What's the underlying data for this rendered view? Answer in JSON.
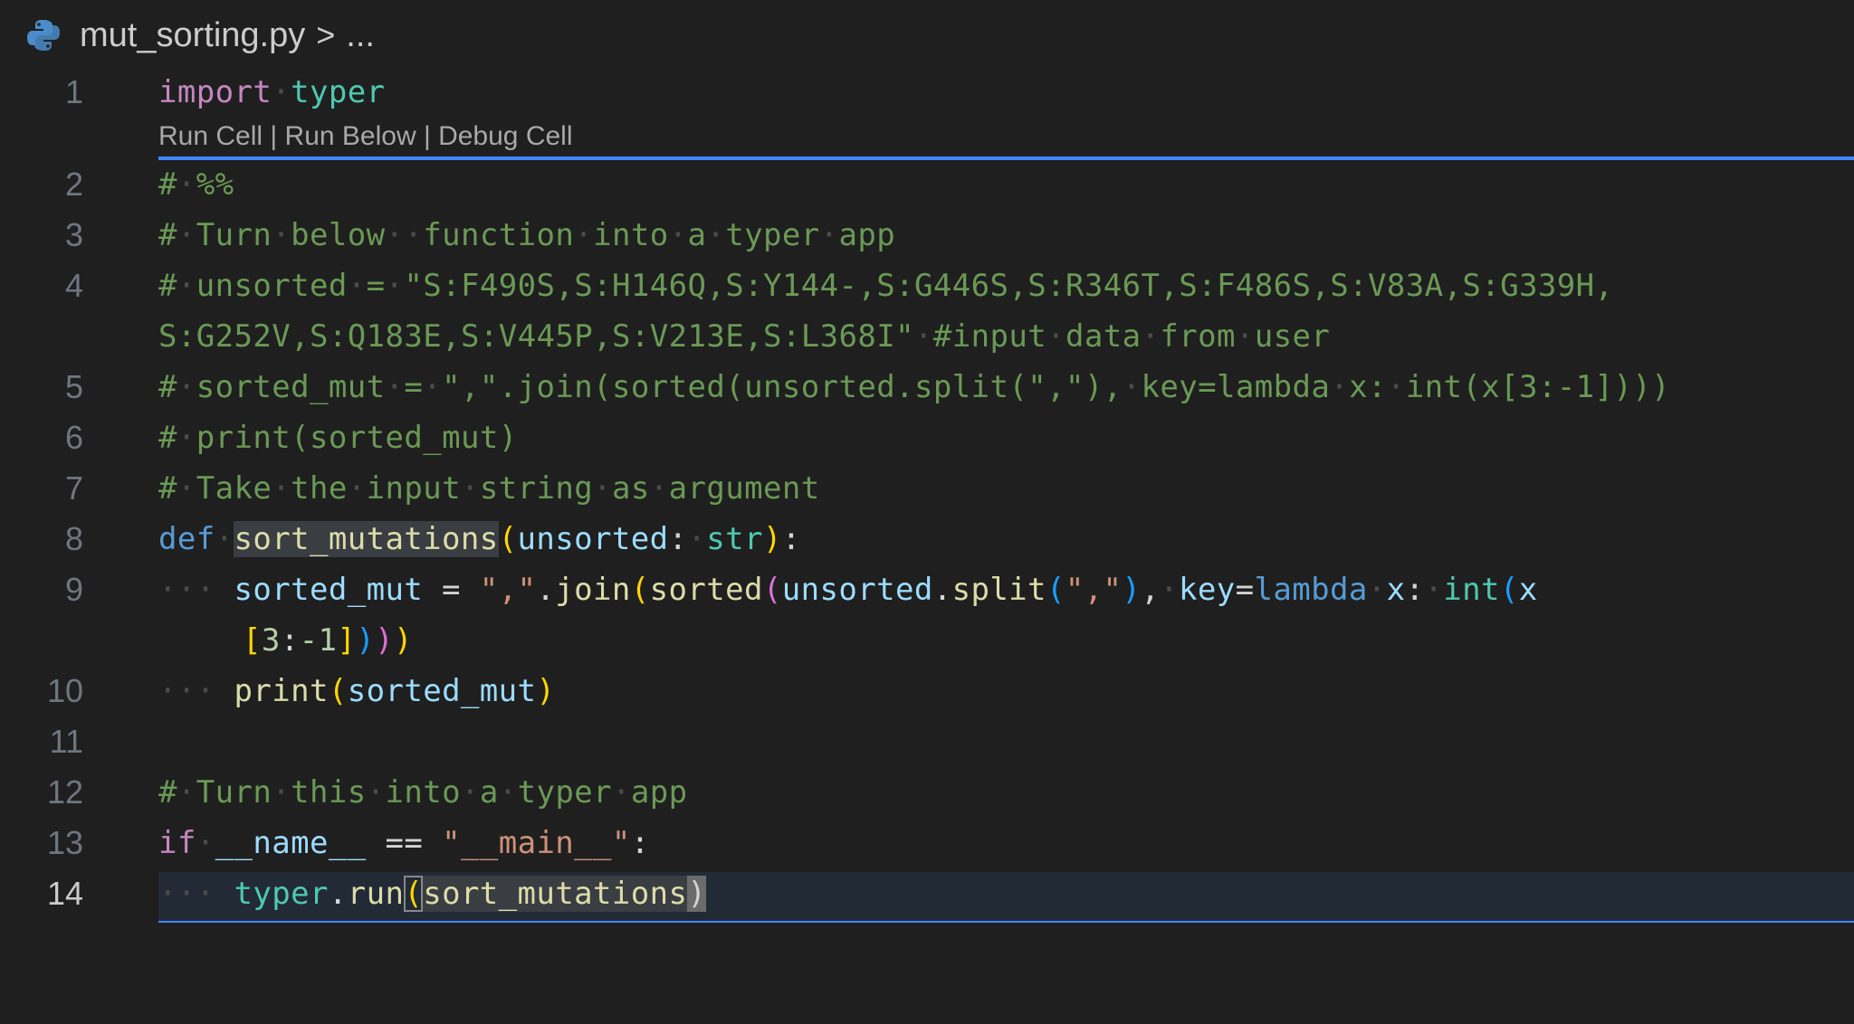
{
  "breadcrumb": {
    "file_name": "mut_sorting.py",
    "separator": ">",
    "ellipsis": "..."
  },
  "codelens": {
    "run_cell": "Run Cell",
    "run_below": "Run Below",
    "debug_cell": "Debug Cell",
    "divider": " | "
  },
  "line_numbers": [
    "1",
    "2",
    "3",
    "4",
    "5",
    "6",
    "7",
    "8",
    "9",
    "10",
    "11",
    "12",
    "13",
    "14"
  ],
  "lines": {
    "l1": {
      "import": "import",
      "module": "typer"
    },
    "l2": {
      "comment": "# %%"
    },
    "l3": {
      "comment": "# Turn below  function into a typer app"
    },
    "l4a": {
      "comment": "# unsorted = \"S:F490S,S:H146Q,S:Y144-,S:G446S,S:R346T,S:F486S,S:V83A,S:G339H,"
    },
    "l4b": {
      "comment": "S:G252V,S:Q183E,S:V445P,S:V213E,S:L368I\" #input data from user"
    },
    "l5": {
      "comment": "# sorted_mut = \",\".join(sorted(unsorted.split(\",\"), key=lambda x: int(x[3:-1])))"
    },
    "l6": {
      "comment": "# print(sorted_mut)"
    },
    "l7": {
      "comment": "# Take the input string as argument"
    },
    "l8": {
      "def": "def",
      "fn": "sort_mutations",
      "param": "unsorted",
      "type": "str"
    },
    "l9": {
      "var": "sorted_mut",
      "str": "\",\"",
      "join": "join",
      "sorted": "sorted",
      "unsorted": "unsorted",
      "split": "split",
      "key": "key",
      "lambda": "lambda",
      "x": "x",
      "int": "int"
    },
    "l9b": {
      "num1": "3",
      "num2": "-1"
    },
    "l10": {
      "print": "print",
      "var": "sorted_mut"
    },
    "l12": {
      "comment": "# Turn this into a typer app"
    },
    "l13": {
      "if": "if",
      "name": "__name__",
      "op": "==",
      "str": "\"__main__\""
    },
    "l14": {
      "module": "typer",
      "fn": "run",
      "arg": "sort_mutations"
    }
  },
  "colors": {
    "background": "#1f1f1f",
    "cell_divider": "#3f86ff",
    "comment": "#6a9955",
    "keyword": "#c586c0",
    "function": "#dcdcaa"
  },
  "icons": {
    "file_icon": "python-icon"
  }
}
